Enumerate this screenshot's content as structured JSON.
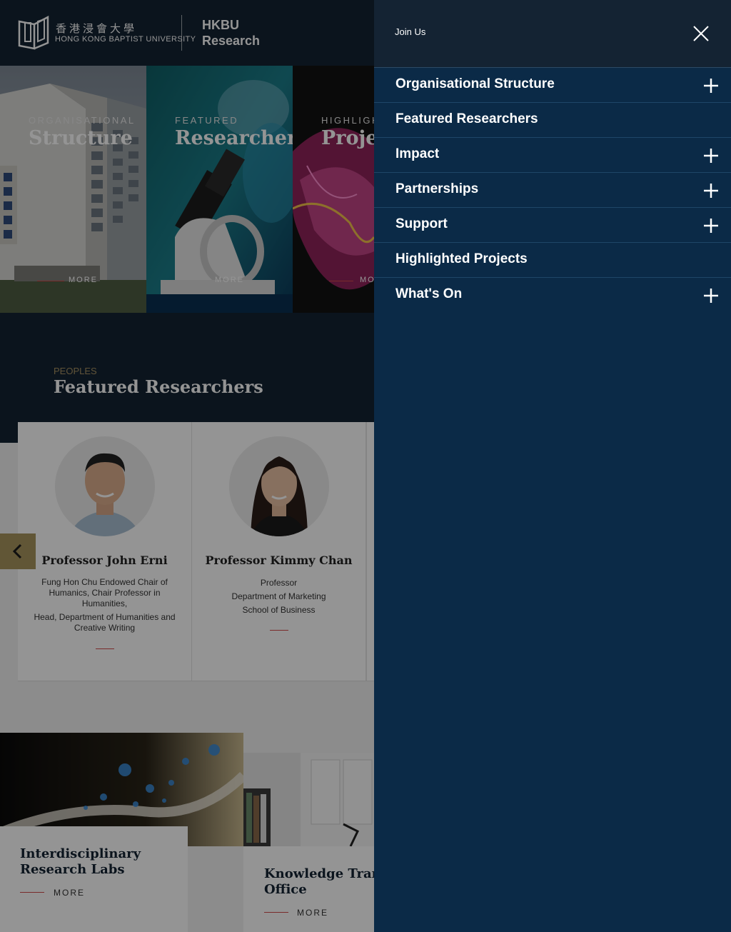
{
  "header": {
    "logo_cn": "香港浸會大學",
    "logo_en": "HONG KONG BAPTIST UNIVERSITY",
    "site_title_line1": "HKBU",
    "site_title_line2": "Research"
  },
  "cards": [
    {
      "kicker": "ORGANISATIONAL",
      "heading": "Structure",
      "more": "MORE"
    },
    {
      "kicker": "FEATURED",
      "heading": "Researchers",
      "more": "MORE"
    },
    {
      "kicker": "HIGHLIGH",
      "heading": "Projec",
      "more": "MO"
    }
  ],
  "featured": {
    "kicker": "PEOPLES",
    "title": "Featured Researchers",
    "researchers": [
      {
        "name": "Professor John Erni",
        "role_1": "Fung Hon Chu Endowed Chair of Humanics, Chair Professor in Humanities,",
        "role_2": "Head, Department of Humanities and Creative Writing"
      },
      {
        "name": "Professor Kimmy Chan",
        "role_1": "Professor",
        "role_2": "Department of Marketing",
        "role_3": "School of Business"
      }
    ]
  },
  "tiles": [
    {
      "title_1": "Interdisciplinary",
      "title_2": "Research Labs",
      "more": "MORE"
    },
    {
      "title_1": "Knowledge Trans",
      "title_2": "Office",
      "more": "MORE"
    }
  ],
  "nav_panel": {
    "join_label": "Join Us",
    "items": [
      {
        "label": "Organisational Structure",
        "expandable": true
      },
      {
        "label": "Featured Researchers",
        "expandable": false
      },
      {
        "label": "Impact",
        "expandable": true
      },
      {
        "label": "Partnerships",
        "expandable": true
      },
      {
        "label": "Support",
        "expandable": true
      },
      {
        "label": "Highlighted Projects",
        "expandable": false
      },
      {
        "label": "What's On",
        "expandable": true
      }
    ]
  },
  "colors": {
    "header_bg": "#142333",
    "panel_bg": "#0b2a47",
    "accent_gold": "#a8945e",
    "accent_red": "#d24a4a"
  }
}
